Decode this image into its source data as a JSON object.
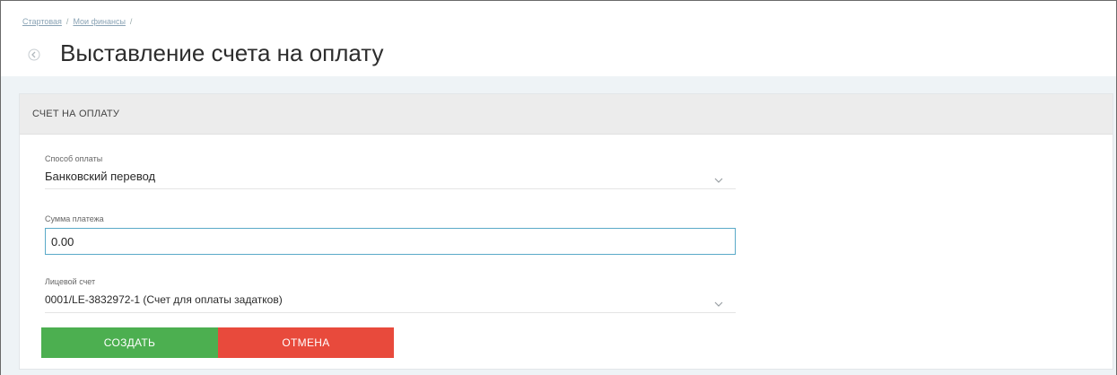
{
  "breadcrumb": {
    "items": [
      "Стартовая",
      "Мои финансы"
    ],
    "separator": "/"
  },
  "header": {
    "title": "Выставление счета на оплату",
    "back_icon": "arrow-left-icon"
  },
  "card": {
    "title": "СЧЕТ НА ОПЛАТУ",
    "payment_method": {
      "label": "Способ оплаты",
      "value": "Банковский перевод"
    },
    "amount": {
      "label": "Сумма платежа",
      "value": "0.00"
    },
    "account": {
      "label": "Лицевой счет",
      "value": "0001/LE-3832972-1 (Счет для оплаты задатков)"
    }
  },
  "actions": {
    "create_label": "СОЗДАТЬ",
    "cancel_label": "ОТМЕНА"
  },
  "colors": {
    "create": "#4caf50",
    "cancel": "#e84a3c",
    "input_focus": "#5aaac8"
  }
}
